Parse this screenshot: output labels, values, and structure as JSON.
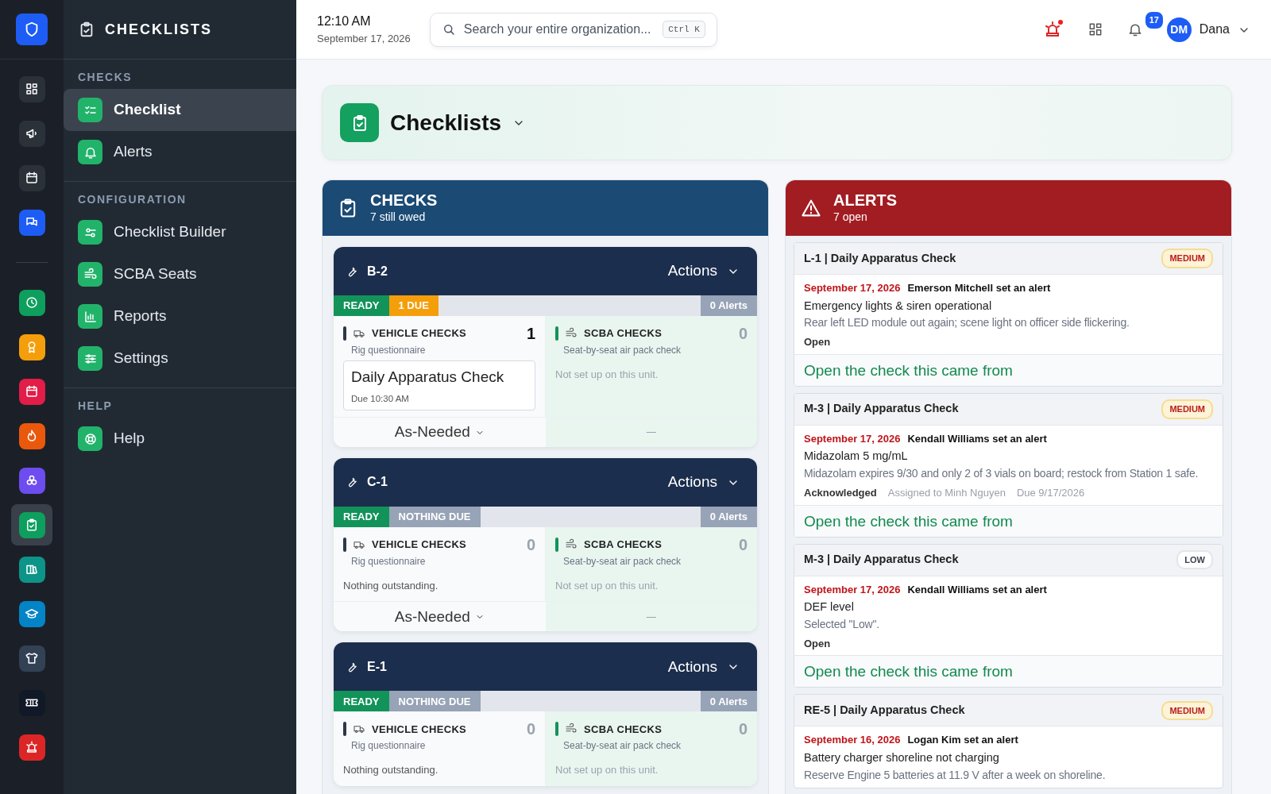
{
  "rail": {
    "items": [
      {
        "color": "#2b3139",
        "selected": false
      },
      {
        "color": "#2b3139",
        "selected": false
      },
      {
        "color": "#2b3139",
        "selected": false
      },
      {
        "color": "#1d5cf5",
        "selected": false
      },
      {
        "color": "#0e9f5e",
        "selected": false
      },
      {
        "color": "#f59e0b",
        "selected": false
      },
      {
        "color": "#e11d48",
        "selected": false
      },
      {
        "color": "#ea580c",
        "selected": false
      },
      {
        "color": "#6d4cf0",
        "selected": false
      },
      {
        "color": "#0e9f5e",
        "selected": true
      },
      {
        "color": "#0d9488",
        "selected": false
      },
      {
        "color": "#0284c7",
        "selected": false
      },
      {
        "color": "#334155",
        "selected": false
      },
      {
        "color": "#111827",
        "selected": false
      },
      {
        "color": "#dc2626",
        "selected": false
      }
    ]
  },
  "sidebar": {
    "title": "CHECKLISTS",
    "sections": [
      {
        "heading": "CHECKS",
        "items": [
          {
            "label": "Checklist",
            "selected": true
          },
          {
            "label": "Alerts",
            "selected": false
          }
        ]
      },
      {
        "heading": "CONFIGURATION",
        "items": [
          {
            "label": "Checklist Builder",
            "selected": false
          },
          {
            "label": "SCBA Seats",
            "selected": false
          },
          {
            "label": "Reports",
            "selected": false
          },
          {
            "label": "Settings",
            "selected": false
          }
        ]
      },
      {
        "heading": "HELP",
        "items": [
          {
            "label": "Help",
            "selected": false
          }
        ]
      }
    ]
  },
  "header": {
    "time": "12:10 AM",
    "date": "September 17, 2026",
    "search": {
      "placeholder": "Search your entire organization...",
      "shortcut": "Ctrl K"
    },
    "notification_count": "17",
    "user": {
      "initials": "DM",
      "name": "Dana"
    }
  },
  "page": {
    "title": "Checklists"
  },
  "checks": {
    "title": "CHECKS",
    "subtitle": "7 still owed",
    "units": [
      {
        "name": "B-2",
        "actions": "Actions",
        "status": "READY",
        "due": {
          "label": "1 DUE",
          "kind": "due"
        },
        "alerts": "0 Alerts",
        "vehicle": {
          "title": "VEHICLE CHECKS",
          "subtitle": "Rig questionnaire",
          "count": "1",
          "active": true,
          "items": [
            {
              "title": "Daily Apparatus Check",
              "due": "Due 10:30 AM"
            }
          ]
        },
        "scba": {
          "title": "SCBA CHECKS",
          "subtitle": "Seat-by-seat air pack check",
          "count": "0",
          "note": "Not set up on this unit."
        },
        "footer": "As-Needed",
        "scba_footer": "—"
      },
      {
        "name": "C-1",
        "actions": "Actions",
        "status": "READY",
        "due": {
          "label": "NOTHING DUE",
          "kind": "none"
        },
        "alerts": "0 Alerts",
        "vehicle": {
          "title": "VEHICLE CHECKS",
          "subtitle": "Rig questionnaire",
          "count": "0",
          "active": false,
          "note": "Nothing outstanding."
        },
        "scba": {
          "title": "SCBA CHECKS",
          "subtitle": "Seat-by-seat air pack check",
          "count": "0",
          "note": "Not set up on this unit."
        },
        "footer": "As-Needed",
        "scba_footer": "—"
      },
      {
        "name": "E-1",
        "actions": "Actions",
        "status": "READY",
        "due": {
          "label": "NOTHING DUE",
          "kind": "none"
        },
        "alerts": "0 Alerts",
        "vehicle": {
          "title": "VEHICLE CHECKS",
          "subtitle": "Rig questionnaire",
          "count": "0",
          "active": false,
          "note": "Nothing outstanding."
        },
        "scba": {
          "title": "SCBA CHECKS",
          "subtitle": "Seat-by-seat air pack check",
          "count": "0",
          "note": "Not set up on this unit."
        }
      }
    ]
  },
  "alerts": {
    "title": "ALERTS",
    "subtitle": "7 open",
    "items": [
      {
        "heading": "L-1 | Daily Apparatus Check",
        "severity": "MEDIUM",
        "kind": "medium",
        "date": "September 17, 2026",
        "author": "Emerson Mitchell set an alert",
        "item": "Emergency lights & siren operational",
        "note": "Rear left LED module out again; scene light on officer side flickering.",
        "status": "Open",
        "link": "Open the check this came from"
      },
      {
        "heading": "M-3 | Daily Apparatus Check",
        "severity": "MEDIUM",
        "kind": "medium",
        "date": "September 17, 2026",
        "author": "Kendall Williams set an alert",
        "item": "Midazolam 5 mg/mL",
        "note": "Midazolam expires 9/30 and only 2 of 3 vials on board; restock from Station 1 safe.",
        "status": "Acknowledged",
        "assigned": "Assigned to Minh Nguyen",
        "due": "Due 9/17/2026",
        "link": "Open the check this came from"
      },
      {
        "heading": "M-3 | Daily Apparatus Check",
        "severity": "LOW",
        "kind": "low",
        "date": "September 17, 2026",
        "author": "Kendall Williams set an alert",
        "item": "DEF level",
        "note": "Selected \"Low\".",
        "status": "Open",
        "link": "Open the check this came from"
      },
      {
        "heading": "RE-5 | Daily Apparatus Check",
        "severity": "MEDIUM",
        "kind": "medium",
        "date": "September 16, 2026",
        "author": "Logan Kim set an alert",
        "item": "Battery charger shoreline not charging",
        "note": "Reserve Engine 5 batteries at 11.9 V after a week on shoreline."
      }
    ]
  }
}
